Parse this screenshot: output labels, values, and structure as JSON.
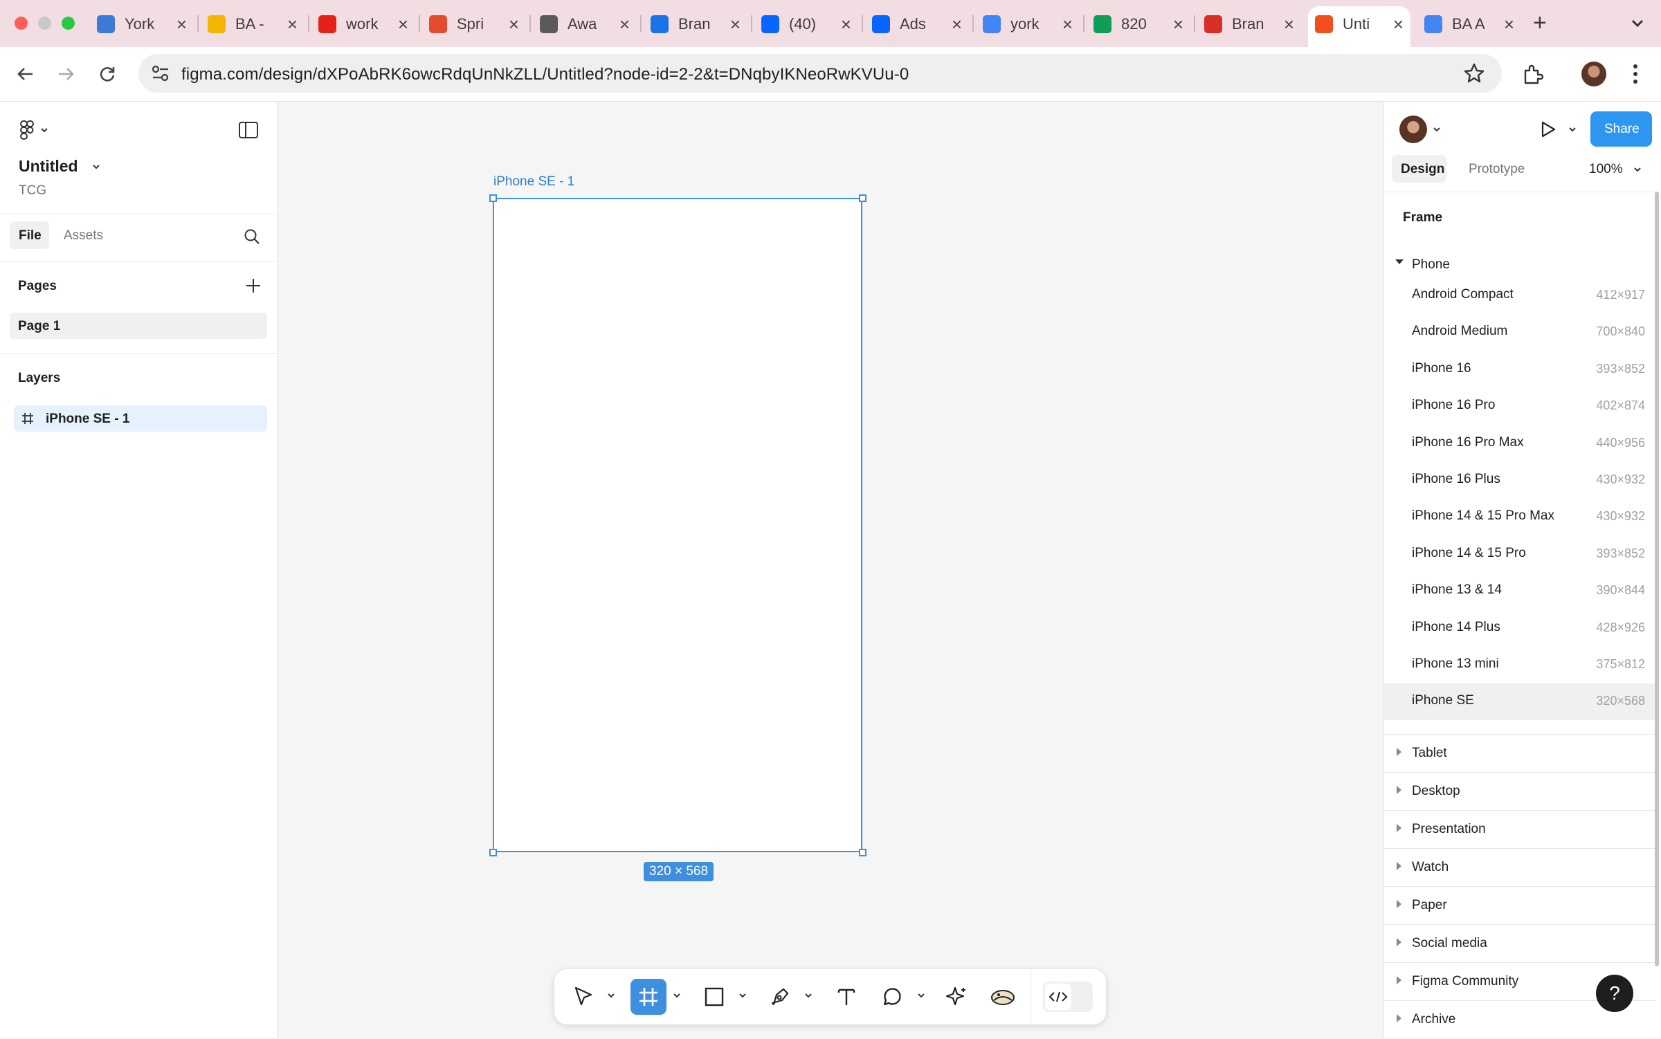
{
  "browser": {
    "tabs": [
      {
        "label": "York",
        "icon": "york-favicon",
        "color": "#3e7bd9"
      },
      {
        "label": "BA -",
        "icon": "slides-favicon",
        "color": "#f4b400"
      },
      {
        "label": "work",
        "icon": "youtube-favicon",
        "color": "#e62117"
      },
      {
        "label": "Spri",
        "icon": "sprinklr-favicon",
        "color": "#e44b2f"
      },
      {
        "label": "Awa",
        "icon": "globe-favicon",
        "color": "#5a5a5a"
      },
      {
        "label": "Bran",
        "icon": "calendar-favicon",
        "color": "#1a73e8"
      },
      {
        "label": "(40)",
        "icon": "meta-favicon",
        "color": "#0866ff"
      },
      {
        "label": "Ads",
        "icon": "meta-favicon",
        "color": "#0866ff"
      },
      {
        "label": "york",
        "icon": "google-favicon",
        "color": "#4285f4"
      },
      {
        "label": "820",
        "icon": "drive-favicon",
        "color": "#0f9d58"
      },
      {
        "label": "Bran",
        "icon": "gmail-favicon",
        "color": "#d93025"
      },
      {
        "label": "Unti",
        "icon": "figma-favicon",
        "color": "#f24e1e",
        "active": true
      },
      {
        "label": "BA A",
        "icon": "docs-favicon",
        "color": "#4285f4"
      }
    ],
    "url": "figma.com/design/dXPoAbRK6owcRdqUnNkZLL/Untitled?node-id=2-2&t=DNqbyIKNeoRwKVUu-0"
  },
  "left_panel": {
    "file_title": "Untitled",
    "team": "TCG",
    "tabs": {
      "file": "File",
      "assets": "Assets"
    },
    "pages_heading": "Pages",
    "pages": [
      "Page 1"
    ],
    "layers_heading": "Layers",
    "layers": [
      "iPhone SE - 1"
    ]
  },
  "canvas": {
    "frame_name": "iPhone SE - 1",
    "frame_size": "320 × 568"
  },
  "right_panel": {
    "share_label": "Share",
    "tabs": {
      "design": "Design",
      "prototype": "Prototype"
    },
    "zoom": "100%",
    "section_title": "Frame",
    "group_title": "Phone",
    "presets": [
      {
        "name": "Android Compact",
        "size": "412×917"
      },
      {
        "name": "Android Medium",
        "size": "700×840"
      },
      {
        "name": "iPhone 16",
        "size": "393×852"
      },
      {
        "name": "iPhone 16 Pro",
        "size": "402×874"
      },
      {
        "name": "iPhone 16 Pro Max",
        "size": "440×956"
      },
      {
        "name": "iPhone 16 Plus",
        "size": "430×932"
      },
      {
        "name": "iPhone 14 & 15 Pro Max",
        "size": "430×932"
      },
      {
        "name": "iPhone 14 & 15 Pro",
        "size": "393×852"
      },
      {
        "name": "iPhone 13 & 14",
        "size": "390×844"
      },
      {
        "name": "iPhone 14 Plus",
        "size": "428×926"
      },
      {
        "name": "iPhone 13 mini",
        "size": "375×812"
      },
      {
        "name": "iPhone SE",
        "size": "320×568",
        "selected": true
      }
    ],
    "categories": [
      "Tablet",
      "Desktop",
      "Presentation",
      "Watch",
      "Paper",
      "Social media",
      "Figma Community",
      "Archive"
    ],
    "help": "?"
  },
  "colors": {
    "accent": "#3d8fe0",
    "share": "#2c96f0",
    "tabstrip": "#f2dde3"
  }
}
